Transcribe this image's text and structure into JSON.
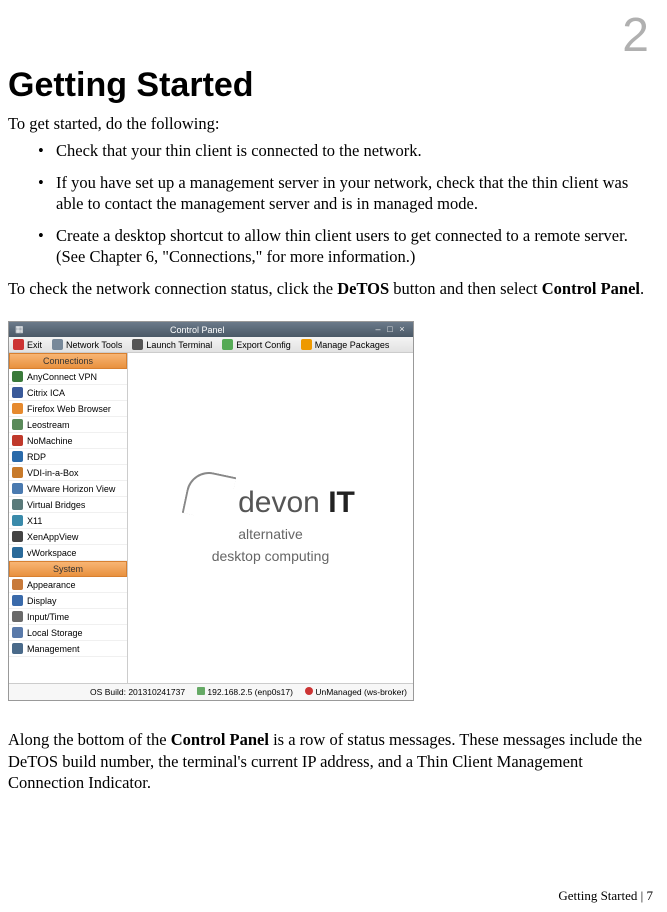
{
  "chapter_num": "2",
  "heading": "Getting Started",
  "intro": "To get started, do the following:",
  "bullets": [
    "Check that your thin client is connected to the network.",
    "If you have set up a management server in your network, check that the thin client was able to contact the management server and is in managed mode.",
    "Create a desktop shortcut to allow thin client users to get connected to a remote server.  (See Chapter 6, \"Connections,\" for more information.)"
  ],
  "check_text_1": "To check the network connection status, click the ",
  "check_bold_1": "DeTOS",
  "check_text_2": " button and then select ",
  "check_bold_2": "Control Panel",
  "check_text_3": ".",
  "screenshot": {
    "title": "Control Panel",
    "menu": {
      "exit": "Exit",
      "net": "Network Tools",
      "term": "Launch Terminal",
      "exp": "Export Config",
      "pkg": "Manage Packages"
    },
    "group1": "Connections",
    "conns": [
      "AnyConnect VPN",
      "Citrix ICA",
      "Firefox Web Browser",
      "Leostream",
      "NoMachine",
      "RDP",
      "VDI-in-a-Box",
      "VMware Horizon View",
      "Virtual Bridges",
      "X11",
      "XenAppView",
      "vWorkspace"
    ],
    "group2": "System",
    "sys": [
      "Appearance",
      "Display",
      "Input/Time",
      "Local Storage",
      "Management"
    ],
    "logo_main": "devon",
    "logo_it": "IT",
    "logo_sub1": "alternative",
    "logo_sub2": "desktop computing",
    "status": {
      "build": "OS Build: 201310241737",
      "ip": "192.168.2.5 (enp0s17)",
      "mgmt": "UnManaged (ws-broker)"
    }
  },
  "closing_1": "Along the bottom of the ",
  "closing_bold": "Control Panel",
  "closing_2": " is a row of status messages.  These messages include the DeTOS build number, the terminal's current IP address, and a Thin Client Management Connection Indicator.",
  "footer": "Getting Started | 7",
  "icon_colors": [
    "#3a7a3a",
    "#3a5a9a",
    "#e68a2e",
    "#5a8a5a",
    "#c0392b",
    "#2a6aaa",
    "#c87a2a",
    "#4a7ab0",
    "#5a7a7a",
    "#3a8aaa",
    "#444",
    "#2a6a9a",
    "#c87a3a",
    "#3a6aaa",
    "#6a6a6a",
    "#5a7aaa",
    "#4a6a8a"
  ]
}
